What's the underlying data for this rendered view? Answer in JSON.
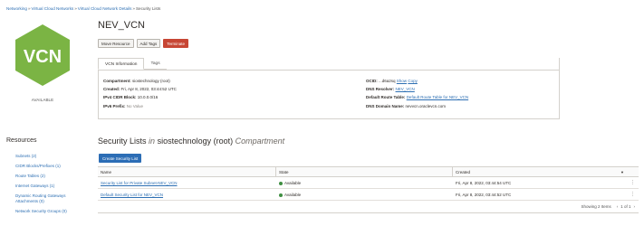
{
  "breadcrumb": [
    "Networking",
    "Virtual Cloud Networks",
    "Virtual Cloud Network Details",
    "Security Lists"
  ],
  "vcn_badge": {
    "text": "VCN",
    "status": "AVAILABLE",
    "color": "#7bb444"
  },
  "title": "NEV_VCN",
  "actions": {
    "move": "Move Resource",
    "tags": "Add Tags",
    "terminate": "Terminate"
  },
  "tabs": [
    "VCN Information",
    "Tags"
  ],
  "info": {
    "compartment_label": "Compartment:",
    "compartment_value": "siostechnology (root)",
    "created_label": "Created:",
    "created_value": "Fri, Apr 8, 2022, 03:44:52 UTC",
    "cidr_label": "IPv4 CIDR Block:",
    "cidr_value": "10.0.0.0/16",
    "ipv6_label": "IPv6 Prefix:",
    "ipv6_value": "No Value",
    "ocid_label": "OCID:",
    "ocid_value": "...d6a2sq",
    "ocid_show": "Show",
    "ocid_copy": "Copy",
    "dns_label": "DNS Resolver:",
    "dns_value": "NEV_VCN",
    "route_label": "Default Route Table:",
    "route_value": "Default Route Table for NEV_VCN",
    "domain_label": "DNS Domain Name:",
    "domain_value": "nevvcn.oraclevcn.com"
  },
  "resources": {
    "title": "Resources",
    "items": [
      "Subnets (2)",
      "CIDR Blocks/Prefixes (1)",
      "Route Tables (2)",
      "Internet Gateways (1)",
      "Dynamic Routing Gateways Attachments (0)",
      "Network Security Groups (0)"
    ]
  },
  "section": {
    "title": "Security Lists",
    "in": "in",
    "compartment": "siostechnology (root)",
    "suffix": "Compartment"
  },
  "create_label": "Create Security List",
  "table": {
    "headers": [
      "Name",
      "State",
      "Created"
    ],
    "rows": [
      {
        "name": "Security List for Private Subnet-NEV_VCN",
        "state": "Available",
        "created": "Fri, Apr 8, 2022, 03:44:54 UTC"
      },
      {
        "name": "Default Security List for NEV_VCN",
        "state": "Available",
        "created": "Fri, Apr 8, 2022, 03:44:52 UTC"
      }
    ],
    "showing": "Showing 2 Items",
    "page": "1 of 1"
  }
}
